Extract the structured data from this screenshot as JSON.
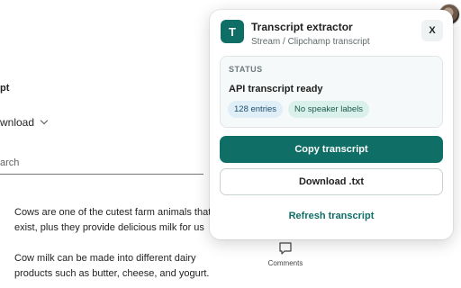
{
  "background": {
    "title_fragment": "pt",
    "download_label": "wnload",
    "search_placeholder": "arch",
    "paragraph1": "Cows are one of the cutest farm animals that exist, plus they provide delicious milk for us",
    "paragraph2": "Cow milk can be made into different dairy products such as butter, cheese, and yogurt.",
    "comments_label": "Comments"
  },
  "popup": {
    "icon_letter": "T",
    "title": "Transcript extractor",
    "subtitle": "Stream / Clipchamp transcript",
    "close_label": "X",
    "status": {
      "heading": "STATUS",
      "text": "API transcript ready",
      "badges": [
        "128 entries",
        "No speaker labels"
      ]
    },
    "buttons": {
      "copy": "Copy transcript",
      "download": "Download .txt",
      "refresh": "Refresh transcript"
    }
  },
  "colors": {
    "accent": "#0f6e66",
    "badge_entries_bg": "#dfeef7",
    "badge_speaker_bg": "#d9f1ea"
  }
}
